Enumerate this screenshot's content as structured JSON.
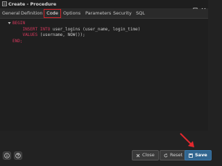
{
  "window": {
    "title": "Create - Procedure"
  },
  "tabs": [
    {
      "label": "General"
    },
    {
      "label": "Definition"
    },
    {
      "label": "Code"
    },
    {
      "label": "Options"
    },
    {
      "label": "Parameters"
    },
    {
      "label": "Security"
    },
    {
      "label": "SQL"
    }
  ],
  "active_tab": "Code",
  "code": {
    "line1": "BEGIN",
    "line2_kw": "INSERT INTO",
    "line2_rest": " user_logins (user_name, login_time)",
    "line3_kw": "VALUES",
    "line3_rest": " (username, NOW());",
    "line4": "END;"
  },
  "footer": {
    "close_label": "Close",
    "reset_label": "Reset",
    "save_label": "Save"
  },
  "colors": {
    "accent": "#326690",
    "highlight": "#d6232a",
    "keyword": "#d8385d"
  }
}
